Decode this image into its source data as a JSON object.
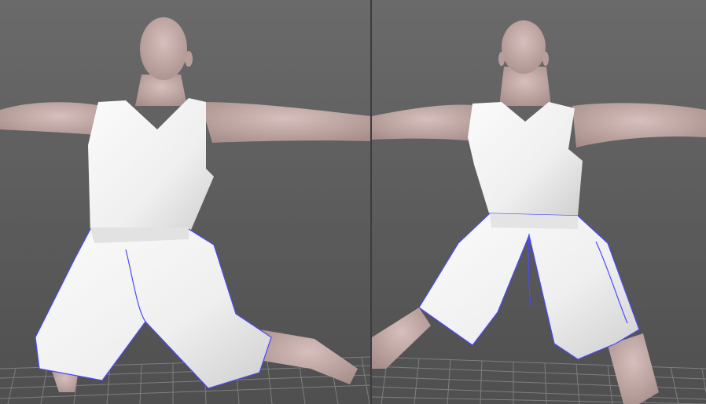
{
  "viewports": [
    {
      "id": "front-view"
    },
    {
      "id": "back-view"
    }
  ],
  "colors": {
    "background_top": "#6a6a6a",
    "background_bottom": "#4f4f4f",
    "grid": "#8a8a8a",
    "skin": "#cbb3b0",
    "skin_shadow": "#9e8683",
    "garment": "#f2f2f2",
    "garment_shadow": "#c9c9c9",
    "seam": "#4a4aff"
  }
}
